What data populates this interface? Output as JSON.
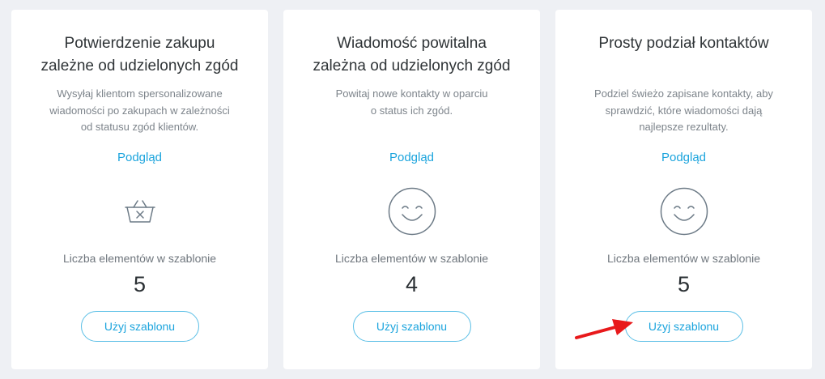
{
  "templates": [
    {
      "title": "Potwierdzenie zakupu\nzależne od udzielonych zgód",
      "description": "Wysyłaj klientom spersonalizowane\nwiadomości po zakupach w zależności\nod statusu zgód klientów.",
      "preview_label": "Podgląd",
      "icon": "shopping-basket-x-icon",
      "count_label": "Liczba elementów w szablonie",
      "count": "5",
      "button_label": "Użyj szablonu"
    },
    {
      "title": "Wiadomość powitalna\nzależna od udzielonych zgód",
      "description": "Powitaj nowe kontakty w oparciu\no status ich zgód.",
      "preview_label": "Podgląd",
      "icon": "smiley-face-icon",
      "count_label": "Liczba elementów w szablonie",
      "count": "4",
      "button_label": "Użyj szablonu"
    },
    {
      "title": "Prosty podział kontaktów",
      "description": "Podziel świeżo zapisane kontakty, aby\nsprawdzić, które wiadomości dają\nnajlepsze rezultaty.",
      "preview_label": "Podgląd",
      "icon": "smiley-face-icon",
      "count_label": "Liczba elementów w szablonie",
      "count": "5",
      "button_label": "Użyj szablonu"
    }
  ],
  "colors": {
    "accent": "#1ba4dd",
    "button_border": "#5bbfe6",
    "annotation_arrow": "#e8191b",
    "background": "#eef0f4"
  },
  "annotation": {
    "icon": "red-arrow-icon"
  }
}
